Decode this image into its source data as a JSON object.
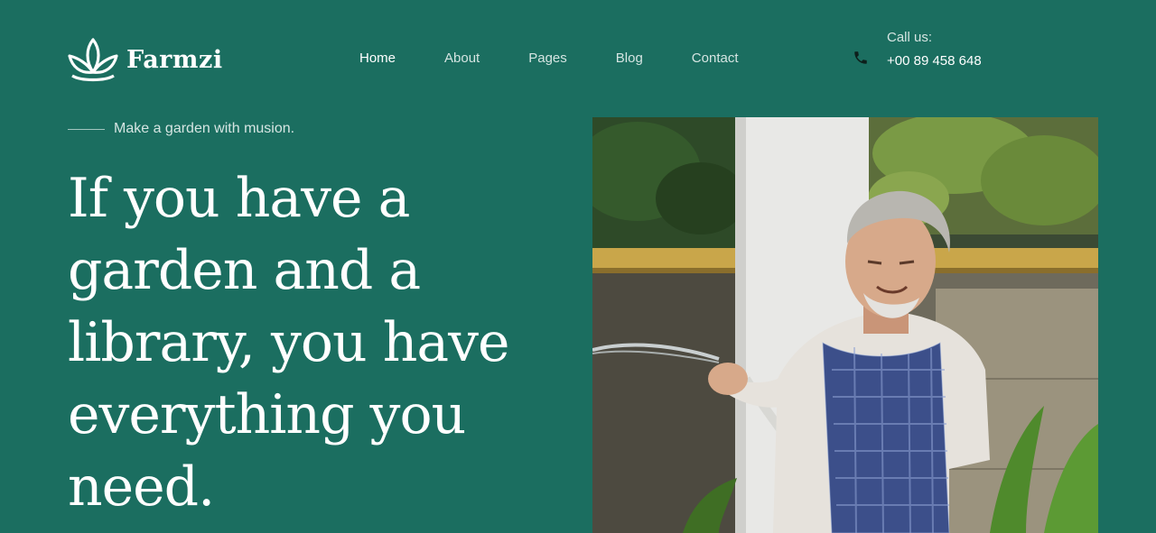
{
  "brand": {
    "name": "Farmzi",
    "logo_icon": "lotus-icon"
  },
  "nav": {
    "items": [
      {
        "label": "Home",
        "active": true
      },
      {
        "label": "About",
        "active": false
      },
      {
        "label": "Pages",
        "active": false
      },
      {
        "label": "Blog",
        "active": false
      },
      {
        "label": "Contact",
        "active": false
      }
    ]
  },
  "contact": {
    "label": "Call us:",
    "phone": "+00 89 458 648",
    "icon": "phone-icon"
  },
  "hero": {
    "tagline": "Make a garden with musion.",
    "headline": "If you have a garden and a library, you have everything you need.",
    "image_alt": "elderly-man-watering-garden-photo"
  },
  "colors": {
    "background": "#1b6e60",
    "text": "#ffffff"
  }
}
